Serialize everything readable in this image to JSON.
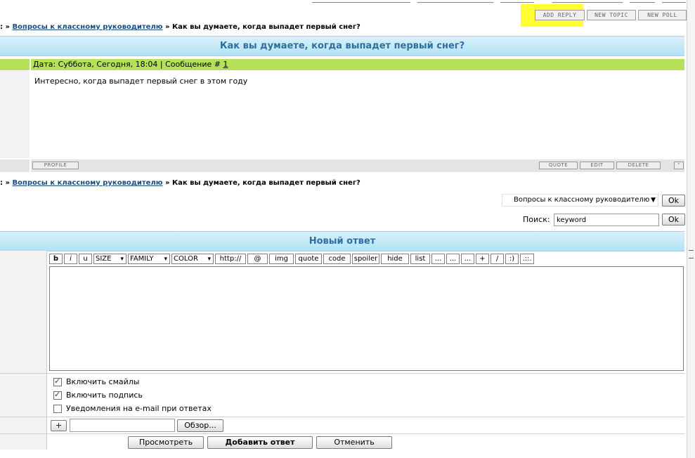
{
  "header": {
    "buttons": [
      {
        "label": "ADD REPLY"
      },
      {
        "label": "NEW TOPIC"
      },
      {
        "label": "NEW POLL"
      }
    ]
  },
  "breadcrumb_top": {
    "sep1": "»",
    "forum_link": "Вопросы к классному руководителю",
    "sep2": "»",
    "current": "Как вы думаете, когда выпадет первый снег?"
  },
  "topic": {
    "title": "Как вы думаете, когда выпадет первый снег?",
    "post": {
      "meta": "Дата: Суббота, Сегодня, 18:04 | Сообщение #",
      "number": "1",
      "body": "Интересно, когда выпадет первый снег в этом году",
      "buttons": {
        "profile": "PROFILE",
        "quote": "QUOTE",
        "edit": "EDIT",
        "delete": "DELETE"
      }
    }
  },
  "breadcrumb_bottom": {
    "sep1": "»",
    "forum_link": "Вопросы к классному руководителю",
    "sep2": "»",
    "current": "Как вы думаете, когда выпадет первый снег?"
  },
  "jump": {
    "selected": "Вопросы к классному руководителю",
    "ok": "Ok"
  },
  "search": {
    "label": "Поиск:",
    "value": "keyword",
    "ok": "Ok"
  },
  "reply": {
    "title": "Новый ответ",
    "toolbar": [
      "b",
      "i",
      "u",
      "SIZE",
      "FAMILY",
      "COLOR",
      "http://",
      "@",
      "img",
      "quote",
      "code",
      "spoiler",
      "hide",
      "list",
      "...",
      "...",
      "...",
      "+",
      "/",
      ":)",
      ".::."
    ],
    "options": [
      {
        "label": "Включить смайлы",
        "checked": true
      },
      {
        "label": "Включить подпись",
        "checked": true
      },
      {
        "label": "Уведомления на e-mail при ответах",
        "checked": false
      }
    ],
    "attach": {
      "plus": "+",
      "browse": "Обзор..."
    },
    "actions": {
      "preview": "Просмотреть",
      "submit": "Добавить ответ",
      "cancel": "Отменить"
    }
  },
  "colors": {
    "highlight": "#ffff33",
    "title_bar": "#b3e2f4",
    "post_header": "#b4e05a"
  }
}
